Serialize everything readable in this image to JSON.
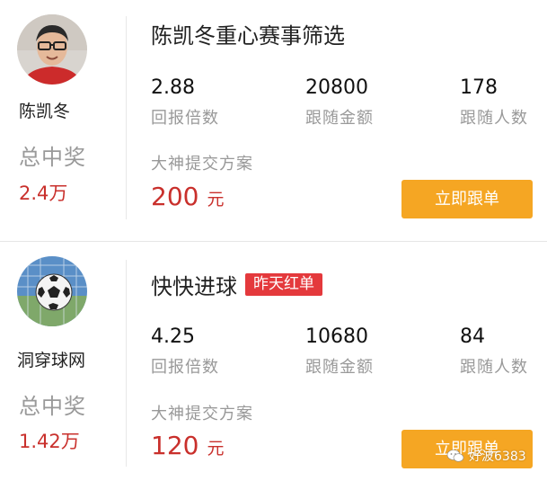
{
  "cards": [
    {
      "user_name": "陈凯冬",
      "total_win_label": "总中奖",
      "total_win_value": "2.4万",
      "title": "陈凯冬重心赛事筛选",
      "badge": "",
      "stats": [
        {
          "value": "2.88",
          "label": "回报倍数"
        },
        {
          "value": "20800",
          "label": "跟随金额"
        },
        {
          "value": "178",
          "label": "跟随人数"
        }
      ],
      "plan_label": "大神提交方案",
      "amount": "200",
      "amount_unit": "元",
      "button_label": "立即跟单"
    },
    {
      "user_name": "洞穿球网",
      "total_win_label": "总中奖",
      "total_win_value": "1.42万",
      "title": "快快进球",
      "badge": "昨天红单",
      "stats": [
        {
          "value": "4.25",
          "label": "回报倍数"
        },
        {
          "value": "10680",
          "label": "跟随金额"
        },
        {
          "value": "84",
          "label": "跟随人数"
        }
      ],
      "plan_label": "大神提交方案",
      "amount": "120",
      "amount_unit": "元",
      "button_label": "立即跟单"
    }
  ],
  "watermark": "好波6383",
  "colors": {
    "accent_red": "#c9302c",
    "badge_red": "#e4393c",
    "button_orange": "#f5a623",
    "muted_text": "#999999"
  },
  "icons": [
    "user-photo-avatar",
    "soccer-ball-avatar",
    "wechat-icon"
  ]
}
